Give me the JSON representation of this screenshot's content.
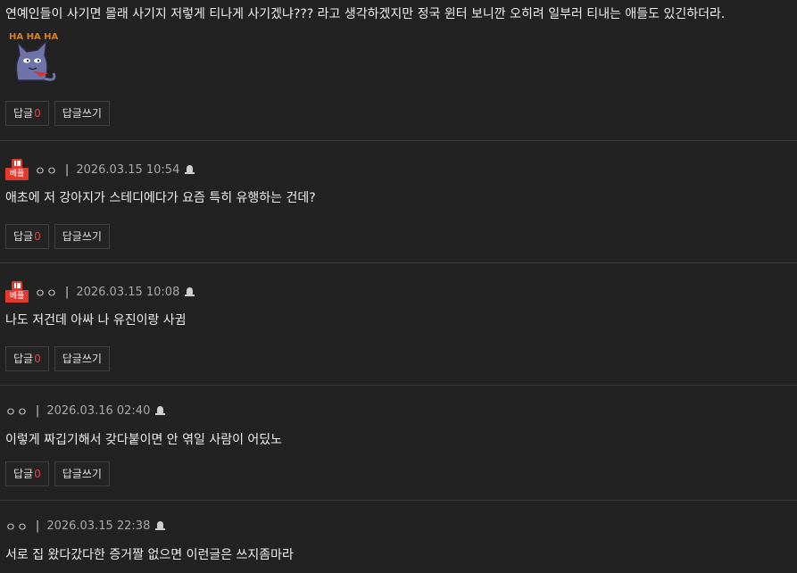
{
  "comments": [
    {
      "text": "연예인들이 사기면 몰래 사기지 저렇게 티나게 사기겠냐??? 라고 생각하겠지만 정국 윈터 보니깐 오히려 일부러 티내는 애들도 있긴하더라.",
      "sticker_text": "HA HA HA",
      "reply_label": "답글",
      "reply_count": "0",
      "write_reply_label": "답글쓰기"
    },
    {
      "badge": "베플",
      "author": "ㅇㅇ",
      "separator": "|",
      "date": "2026.03.15 10:54",
      "text": "애초에 저 강아지가 스테디에다가 요즘 특히 유행하는 건데?",
      "reply_label": "답글",
      "reply_count": "0",
      "write_reply_label": "답글쓰기"
    },
    {
      "badge": "베플",
      "author": "ㅇㅇ",
      "separator": "|",
      "date": "2026.03.15 10:08",
      "text": "나도 저건데 아싸 나 유진이랑 사귐",
      "reply_label": "답글",
      "reply_count": "0",
      "write_reply_label": "답글쓰기"
    },
    {
      "author": "ㅇㅇ",
      "separator": "|",
      "date": "2026.03.16 02:40",
      "text": "이렇게 짜깁기해서 갖다붙이면 안 엮일 사람이 어딨노",
      "reply_label": "답글",
      "reply_count": "0",
      "write_reply_label": "답글쓰기"
    },
    {
      "author": "ㅇㅇ",
      "separator": "|",
      "date": "2026.03.15 22:38",
      "text": "서로 집 왔다갔다한 증거짤 없으면 이런글은 쓰지좀마라"
    }
  ],
  "colors": {
    "background": "#222222",
    "best_badge": "#e03a2f",
    "reply_count": "#e0453a"
  },
  "icons": {
    "report": "bell-icon"
  }
}
